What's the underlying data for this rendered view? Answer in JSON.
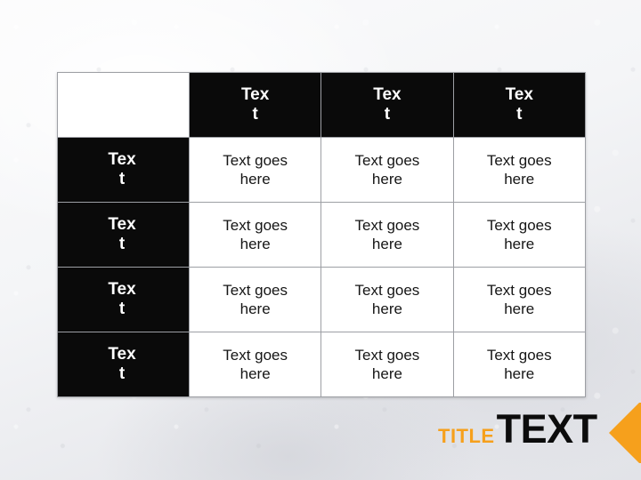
{
  "slide": {
    "background_color": "#eef0f3",
    "accent_color": "#f6a01c",
    "header_fill": "#0a0a0a",
    "cell_fill": "#ffffff",
    "grid_line_color": "#9d9fa4"
  },
  "table": {
    "corner_cell": "",
    "column_headers": [
      "Text",
      "Text",
      "Text"
    ],
    "row_headers": [
      "Text",
      "Text",
      "Text",
      "Text"
    ],
    "rows": [
      [
        "Text goes here",
        "Text goes here",
        "Text goes here"
      ],
      [
        "Text goes here",
        "Text goes here",
        "Text goes here"
      ],
      [
        "Text goes here",
        "Text goes here",
        "Text goes here"
      ],
      [
        "Text goes here",
        "Text goes here",
        "Text goes here"
      ]
    ]
  },
  "title": {
    "small_word": "TITLE",
    "large_word": "TEXT",
    "small_word_color": "#f6a01c",
    "large_word_color": "#0c0c0c"
  },
  "decoration": {
    "chevron_color": "#f6a01c",
    "chevron_direction": "left"
  }
}
